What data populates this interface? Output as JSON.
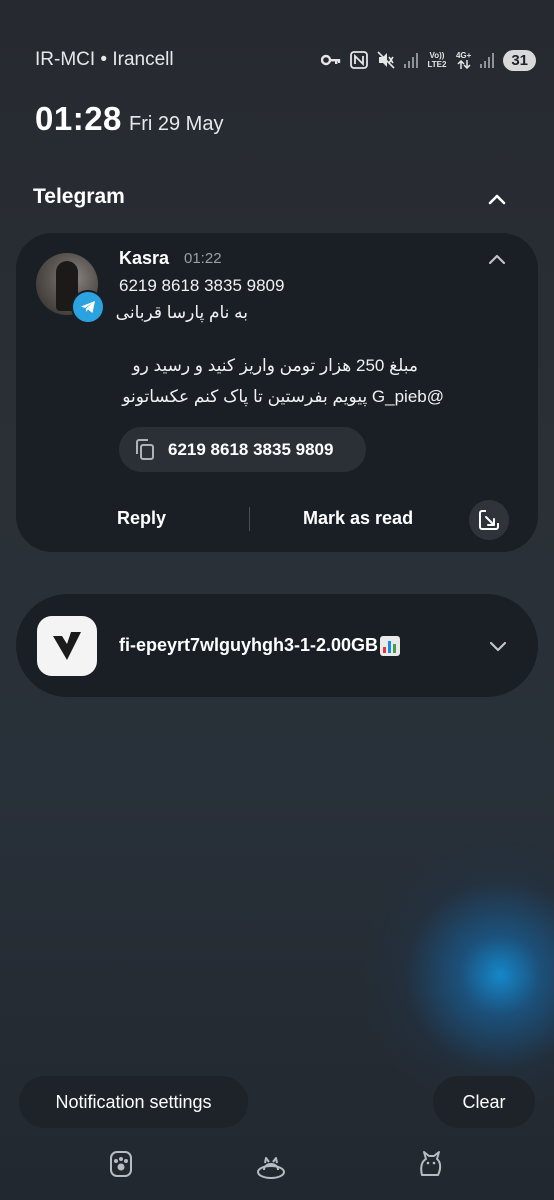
{
  "status_bar": {
    "carrier": "IR-MCI • Irancell",
    "volte_label": "Vo)) LTE2",
    "net_label": "4G+",
    "battery": "31",
    "icons": [
      "key-icon",
      "nfc-icon",
      "mute-icon",
      "signal-icon",
      "signal-icon",
      "data-arrows-icon",
      "battery-icon"
    ]
  },
  "clock": {
    "time": "01:28",
    "date": "Fri 29 May"
  },
  "telegram_group": {
    "app_name": "Telegram",
    "notification": {
      "sender": "Kasra",
      "time": "01:22",
      "line1": "6219 8618 3835 9809",
      "line2": "به نام پارسا قربانی",
      "line3": "مبلغ 250 هزار تومن واریز کنید و رسید رو",
      "line4": "@G_pieb پیویم بفرستین تا پاک کنم عکساتونو",
      "copy_chip_text": "6219 8618 3835 9809",
      "actions": {
        "reply": "Reply",
        "mark_read": "Mark as read"
      }
    },
    "accent_color": "#2aa3e0"
  },
  "vpn_notification": {
    "text": "fi-epeyrt7wlguyhgh3-1-2.00GB"
  },
  "bottom": {
    "settings_label": "Notification settings",
    "clear_label": "Clear"
  }
}
